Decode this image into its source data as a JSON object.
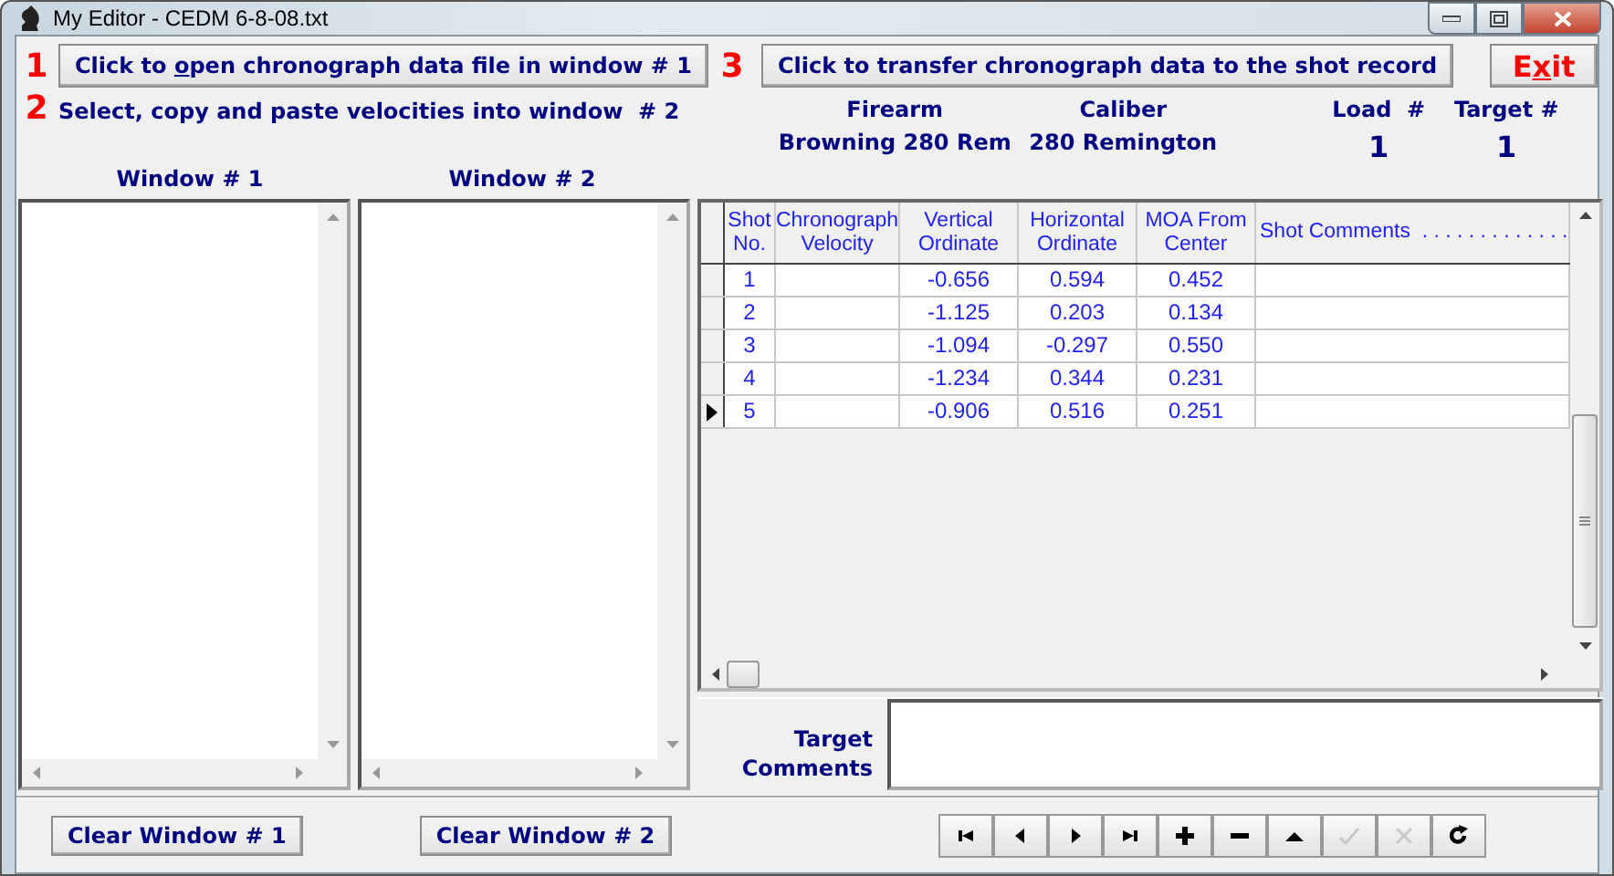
{
  "window": {
    "title": "My Editor - CEDM 6-8-08.txt"
  },
  "steps": [
    {
      "number": "1",
      "kind": "button",
      "label_before": "Click to ",
      "access_key": "o",
      "label_after": "pen chronograph data file in window # 1"
    },
    {
      "number": "2",
      "kind": "text",
      "label_before": "Select, copy and paste velocities into window  # 2"
    },
    {
      "number": "3",
      "kind": "button",
      "label_before": "Click to transfer chronograph data to the shot record"
    }
  ],
  "exit_button": {
    "label_before": "E",
    "access_key": "x",
    "label_after": "it"
  },
  "info": {
    "firearm_label": "Firearm",
    "firearm": "Browning 280 Rem",
    "caliber_label": "Caliber",
    "caliber": "280 Remington",
    "load_label": "Load  #",
    "load": "1",
    "target_label": "Target #",
    "target": "1"
  },
  "panes": [
    {
      "title": "Window # 1",
      "clear_button": "Clear Window # 1"
    },
    {
      "title": "Window # 2",
      "clear_button": "Clear Window # 2"
    }
  ],
  "table": {
    "columns": [
      "Shot No.",
      "Chronograph Velocity",
      "Vertical Ordinate",
      "Horizontal Ordinate",
      "MOA From Center",
      "Shot Comments  . . . . . . . . . . . . ."
    ],
    "rows": [
      {
        "current": false,
        "cells": [
          "1",
          "",
          "-0.656",
          "0.594",
          "0.452",
          ""
        ]
      },
      {
        "current": false,
        "cells": [
          "2",
          "",
          "-1.125",
          "0.203",
          "0.134",
          ""
        ]
      },
      {
        "current": false,
        "cells": [
          "3",
          "",
          "-1.094",
          "-0.297",
          "0.550",
          ""
        ]
      },
      {
        "current": false,
        "cells": [
          "4",
          "",
          "-1.234",
          "0.344",
          "0.231",
          ""
        ]
      },
      {
        "current": true,
        "cells": [
          "5",
          "",
          "-0.906",
          "0.516",
          "0.251",
          ""
        ]
      }
    ]
  },
  "target_comments": {
    "label": "Target Comments"
  },
  "navigator": [
    {
      "kind": "first",
      "disabled": false
    },
    {
      "kind": "prev",
      "disabled": false
    },
    {
      "kind": "next",
      "disabled": false
    },
    {
      "kind": "last",
      "disabled": false
    },
    {
      "kind": "add",
      "disabled": false
    },
    {
      "kind": "delete",
      "disabled": false
    },
    {
      "kind": "edit",
      "disabled": false
    },
    {
      "kind": "post",
      "disabled": true
    },
    {
      "kind": "cancel",
      "disabled": true
    },
    {
      "kind": "refresh",
      "disabled": false
    }
  ]
}
